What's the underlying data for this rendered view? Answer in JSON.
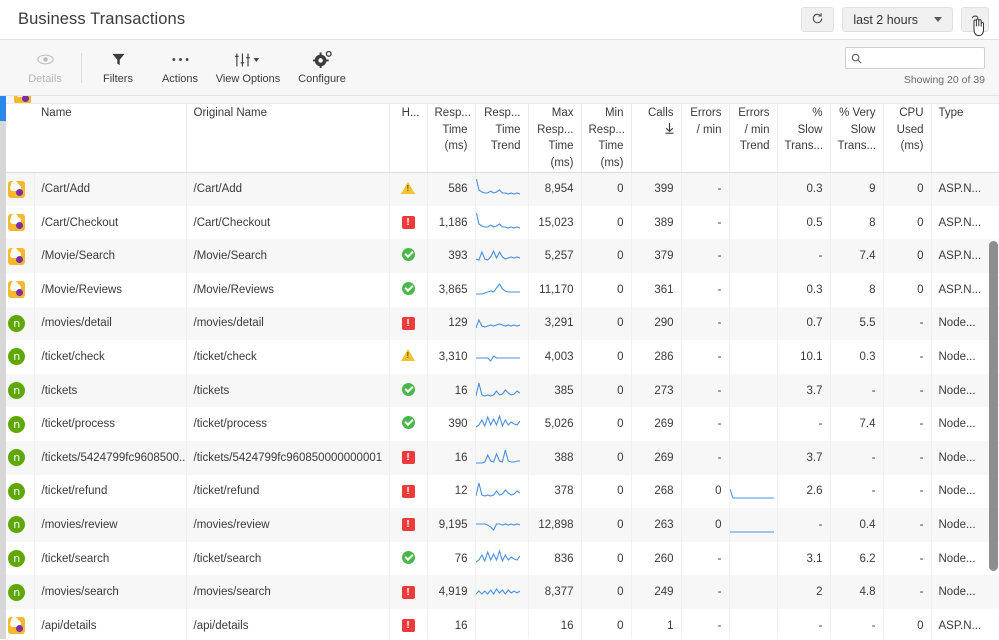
{
  "header": {
    "title": "Business Transactions",
    "refresh_icon": "refresh-icon",
    "time_range": "last 2 hours",
    "help_label": "?"
  },
  "toolbar": {
    "items": [
      {
        "label": "Details",
        "icon": "eye-icon",
        "disabled": true
      },
      {
        "label": "Filters",
        "icon": "funnel-icon",
        "disabled": false
      },
      {
        "label": "Actions",
        "icon": "ellipsis-icon",
        "disabled": false
      },
      {
        "label": "View Options",
        "icon": "sliders-icon",
        "disabled": false
      },
      {
        "label": "Configure",
        "icon": "gear-icon",
        "disabled": false
      }
    ],
    "search": {
      "placeholder": "",
      "value": "",
      "icon": "search-icon"
    },
    "showing": "Showing 20 of 39"
  },
  "table": {
    "columns": [
      {
        "label": "Name",
        "align": "left"
      },
      {
        "label": "Original Name",
        "align": "left"
      },
      {
        "label": "H...",
        "align": "right"
      },
      {
        "label": "Resp...\nTime\n(ms)",
        "align": "right"
      },
      {
        "label": "Resp...\nTime\nTrend",
        "align": "right"
      },
      {
        "label": "Max\nResp...\nTime\n(ms)",
        "align": "right"
      },
      {
        "label": "Min\nResp...\nTime\n(ms)",
        "align": "right"
      },
      {
        "label": "Calls",
        "align": "right",
        "sorted": "desc"
      },
      {
        "label": "Errors\n/ min",
        "align": "right"
      },
      {
        "label": "Errors\n/ min\nTrend",
        "align": "right"
      },
      {
        "label": "% Slow\nTrans...",
        "align": "right"
      },
      {
        "label": "% Very\nSlow\nTrans...",
        "align": "right"
      },
      {
        "label": "CPU\nUsed\n(ms)",
        "align": "right"
      },
      {
        "label": "Type",
        "align": "left"
      }
    ],
    "rows": [
      {
        "platform": "dotnet-icon",
        "name": "/Cart/Add",
        "original": "/Cart/Add",
        "health": "warning-icon",
        "resp": "586",
        "trend": "flat-decay",
        "max": "8,954",
        "min": "0",
        "calls": "399",
        "errors": "-",
        "errtrend": "",
        "slow": "0.3",
        "veryslow": "9",
        "cpu": "0",
        "type": "ASP.N..."
      },
      {
        "platform": "dotnet-icon",
        "name": "/Cart/Checkout",
        "original": "/Cart/Checkout",
        "health": "critical-icon",
        "resp": "1,186",
        "trend": "flat-decay",
        "max": "15,023",
        "min": "0",
        "calls": "389",
        "errors": "-",
        "errtrend": "",
        "slow": "0.5",
        "veryslow": "8",
        "cpu": "0",
        "type": "ASP.N..."
      },
      {
        "platform": "dotnet-icon",
        "name": "/Movie/Search",
        "original": "/Movie/Search",
        "health": "ok-icon",
        "resp": "393",
        "trend": "bumpy",
        "max": "5,257",
        "min": "0",
        "calls": "379",
        "errors": "-",
        "errtrend": "",
        "slow": "-",
        "veryslow": "7.4",
        "cpu": "0",
        "type": "ASP.N..."
      },
      {
        "platform": "dotnet-icon",
        "name": "/Movie/Reviews",
        "original": "/Movie/Reviews",
        "health": "ok-icon",
        "resp": "3,865",
        "trend": "rise-mid",
        "max": "11,170",
        "min": "0",
        "calls": "361",
        "errors": "-",
        "errtrend": "",
        "slow": "0.3",
        "veryslow": "8",
        "cpu": "0",
        "type": "ASP.N..."
      },
      {
        "platform": "node-icon",
        "name": "/movies/detail",
        "original": "/movies/detail",
        "health": "critical-icon",
        "resp": "129",
        "trend": "low-flat",
        "max": "3,291",
        "min": "0",
        "calls": "290",
        "errors": "-",
        "errtrend": "",
        "slow": "0.7",
        "veryslow": "5.5",
        "cpu": "-",
        "type": "Node..."
      },
      {
        "platform": "node-icon",
        "name": "/ticket/check",
        "original": "/ticket/check",
        "health": "warning-icon",
        "resp": "3,310",
        "trend": "straight",
        "max": "4,003",
        "min": "0",
        "calls": "286",
        "errors": "-",
        "errtrend": "",
        "slow": "10.1",
        "veryslow": "0.3",
        "cpu": "-",
        "type": "Node..."
      },
      {
        "platform": "node-icon",
        "name": "/tickets",
        "original": "/tickets",
        "health": "ok-icon",
        "resp": "16",
        "trend": "spike-left",
        "max": "385",
        "min": "0",
        "calls": "273",
        "errors": "-",
        "errtrend": "",
        "slow": "3.7",
        "veryslow": "-",
        "cpu": "-",
        "type": "Node..."
      },
      {
        "platform": "node-icon",
        "name": "/ticket/process",
        "original": "/ticket/process",
        "health": "ok-icon",
        "resp": "390",
        "trend": "jagged",
        "max": "5,026",
        "min": "0",
        "calls": "269",
        "errors": "-",
        "errtrend": "",
        "slow": "-",
        "veryslow": "7.4",
        "cpu": "-",
        "type": "Node..."
      },
      {
        "platform": "node-icon",
        "name": "/tickets/5424799fc9608500...",
        "original": "/tickets/5424799fc960850000000001",
        "health": "critical-icon",
        "resp": "16",
        "trend": "spikes-right",
        "max": "388",
        "min": "0",
        "calls": "269",
        "errors": "-",
        "errtrend": "",
        "slow": "3.7",
        "veryslow": "-",
        "cpu": "-",
        "type": "Node..."
      },
      {
        "platform": "node-icon",
        "name": "/ticket/refund",
        "original": "/ticket/refund",
        "health": "critical-icon",
        "resp": "12",
        "trend": "spike-left",
        "max": "378",
        "min": "0",
        "calls": "268",
        "errors": "0",
        "errtrend": "err-flat",
        "slow": "2.6",
        "veryslow": "-",
        "cpu": "-",
        "type": "Node..."
      },
      {
        "platform": "node-icon",
        "name": "/movies/review",
        "original": "/movies/review",
        "health": "critical-icon",
        "resp": "9,195",
        "trend": "straight-dip",
        "max": "12,898",
        "min": "0",
        "calls": "263",
        "errors": "0",
        "errtrend": "err-line",
        "slow": "-",
        "veryslow": "0.4",
        "cpu": "-",
        "type": "Node..."
      },
      {
        "platform": "node-icon",
        "name": "/ticket/search",
        "original": "/ticket/search",
        "health": "ok-icon",
        "resp": "76",
        "trend": "jagged",
        "max": "836",
        "min": "0",
        "calls": "260",
        "errors": "-",
        "errtrend": "",
        "slow": "3.1",
        "veryslow": "6.2",
        "cpu": "-",
        "type": "Node..."
      },
      {
        "platform": "node-icon",
        "name": "/movies/search",
        "original": "/movies/search",
        "health": "critical-icon",
        "resp": "4,919",
        "trend": "wavy",
        "max": "8,377",
        "min": "0",
        "calls": "249",
        "errors": "-",
        "errtrend": "",
        "slow": "2",
        "veryslow": "4.8",
        "cpu": "-",
        "type": "Node..."
      },
      {
        "platform": "dotnet-icon",
        "name": "/api/details",
        "original": "/api/details",
        "health": "critical-icon",
        "resp": "16",
        "trend": "",
        "max": "16",
        "min": "0",
        "calls": "1",
        "errors": "-",
        "errtrend": "",
        "slow": "-",
        "veryslow": "-",
        "cpu": "0",
        "type": "ASP.N..."
      }
    ]
  },
  "colors": {
    "accent_blue": "#2c87e8",
    "error_red": "#e8493f",
    "ok_green": "#49b749",
    "warn_yellow": "#f2c230",
    "crit_red": "#ed3b3b",
    "node_green": "#5fa804",
    "dotnet_orange": "#f5b82e",
    "spark_blue": "#4a90e2"
  }
}
